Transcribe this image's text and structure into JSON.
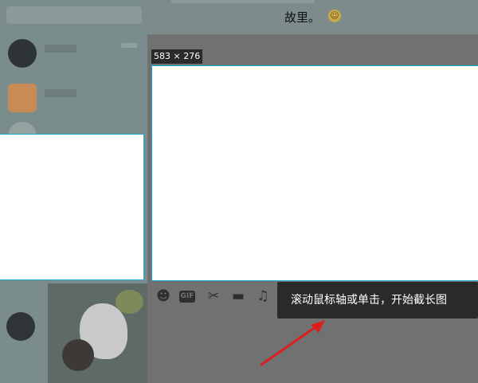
{
  "chat": {
    "title": "故里。",
    "title_emoji_icon": "smiley-emoji-icon",
    "title_emoji_glyph": "☺"
  },
  "toolbar": {
    "icons": [
      {
        "name": "emoji-icon",
        "glyph": "☻"
      },
      {
        "name": "gif-icon",
        "glyph": "GIF"
      },
      {
        "name": "scissors-icon",
        "glyph": "✂"
      },
      {
        "name": "folder-icon",
        "glyph": "▬"
      },
      {
        "name": "music-icon",
        "glyph": "♫"
      }
    ]
  },
  "screenshot": {
    "size_label": "583 × 276",
    "tip_text": "滚动鼠标轴或单击，开始截长图",
    "accent_color": "#1aa3d6",
    "arrow_color": "#d91f1f"
  }
}
